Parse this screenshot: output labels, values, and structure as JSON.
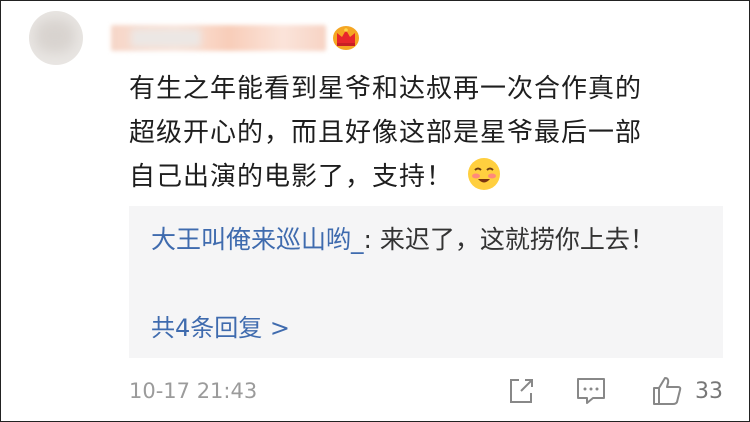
{
  "comment": {
    "line1": "有生之年能看到星爷和达叔再一次合作真的",
    "line2": "超级开心的，而且好像这部是星爷最后一部",
    "line3": "自己出演的电影了，支持！"
  },
  "reply": {
    "user": "大王叫俺来巡山哟_",
    "separator": ": ",
    "text": "来迟了，这就捞你上去！"
  },
  "more_replies": "共4条回复 >",
  "footer": {
    "timestamp": "10-17 21:43",
    "like_count": "33"
  },
  "colors": {
    "link": "#3f6bae",
    "reply_bg": "#f5f5f6",
    "meta": "#9b9b9b"
  }
}
